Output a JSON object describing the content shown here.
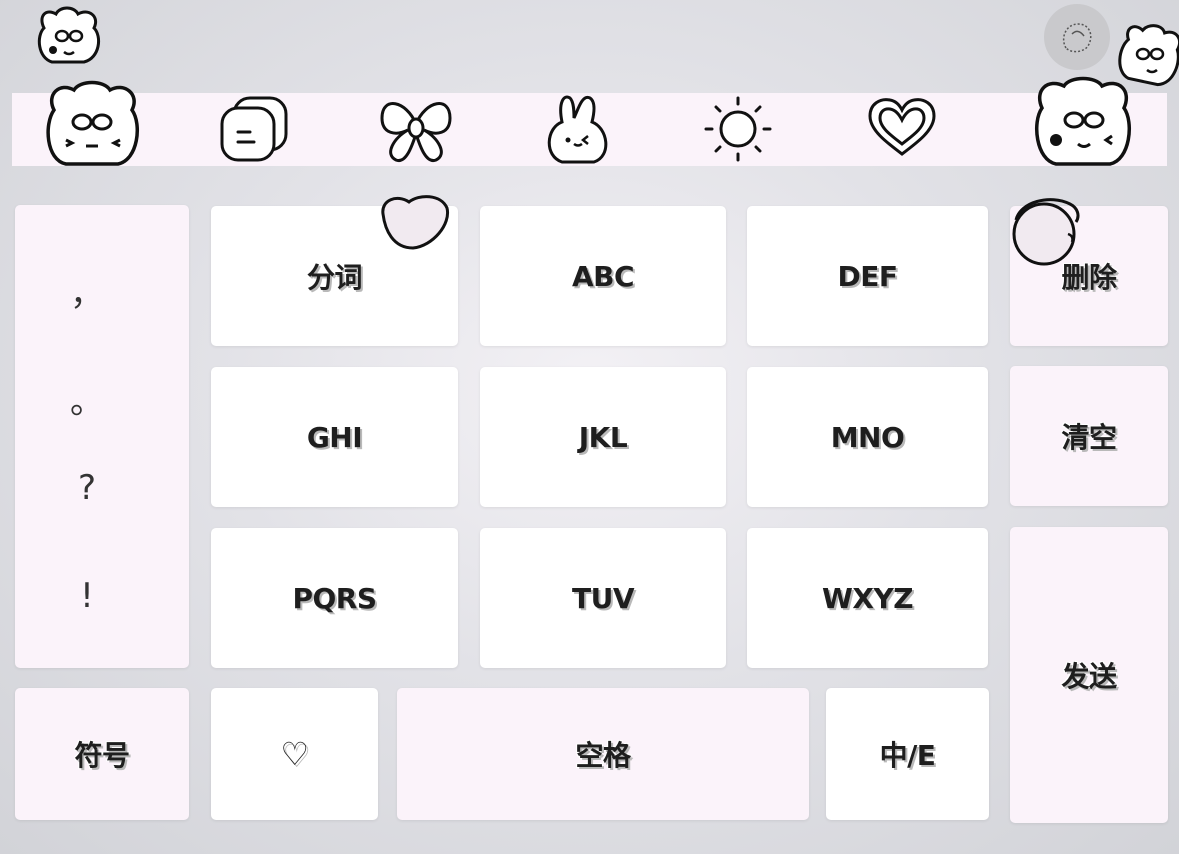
{
  "toolbar": {
    "icons": [
      "bunny-face-icon",
      "chat-bubble-icon",
      "bow-icon",
      "rabbit-icon",
      "sun-icon",
      "heart-icon",
      "bunny-face-icon"
    ]
  },
  "punctuation": {
    "comma": "，",
    "period": "。",
    "question": "?",
    "exclamation": "!"
  },
  "keys": {
    "row1": [
      "分词",
      "ABC",
      "DEF"
    ],
    "row2": [
      "GHI",
      "JKL",
      "MNO"
    ],
    "row3": [
      "PQRS",
      "TUV",
      "WXYZ"
    ],
    "delete": "删除",
    "clear": "清空",
    "send": "发送",
    "symbols": "符号",
    "heart": "♡",
    "space": "空格",
    "lang_toggle": "中/E"
  },
  "colors": {
    "key_white": "#ffffff",
    "key_pink": "#fbf3fa",
    "toolbar_bg": "#fbf3fa",
    "text": "#1e1e1e"
  }
}
